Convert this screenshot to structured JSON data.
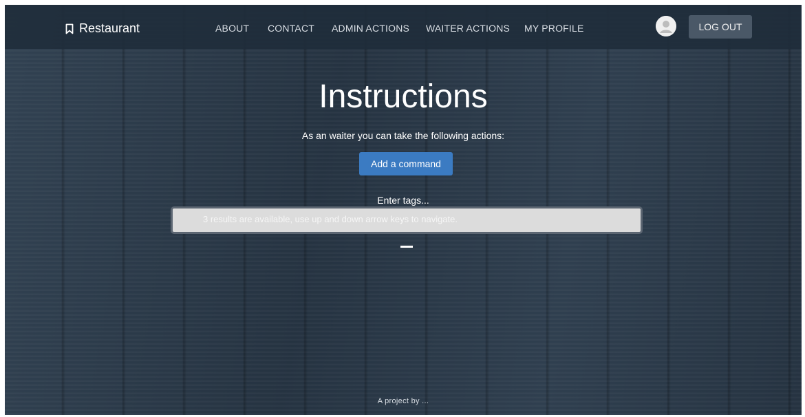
{
  "brand": {
    "name": "Restaurant",
    "icon": "bookmark-icon"
  },
  "nav": {
    "items": [
      {
        "label": "ABOUT"
      },
      {
        "label": "CONTACT"
      },
      {
        "label": "ADMIN ACTIONS"
      },
      {
        "label": "WAITER ACTIONS"
      },
      {
        "label": "MY PROFILE"
      }
    ],
    "avatar_icon": "user-avatar-icon",
    "logout_label": "LOG OUT"
  },
  "main": {
    "title": "Instructions",
    "subtitle": "As an waiter you can take the following actions:",
    "action_button": "Add a command",
    "tags_label": "Enter tags...",
    "tags_hint": "3 results are available, use up and down arrow keys to navigate."
  },
  "footer": {
    "text": "A project by ..."
  },
  "colors": {
    "navbar": "#1f2c3a",
    "background": "#2b3a49",
    "primary_button": "#3b7bc2",
    "logout_button": "#4a5867",
    "input_background": "#dcdcdc"
  }
}
